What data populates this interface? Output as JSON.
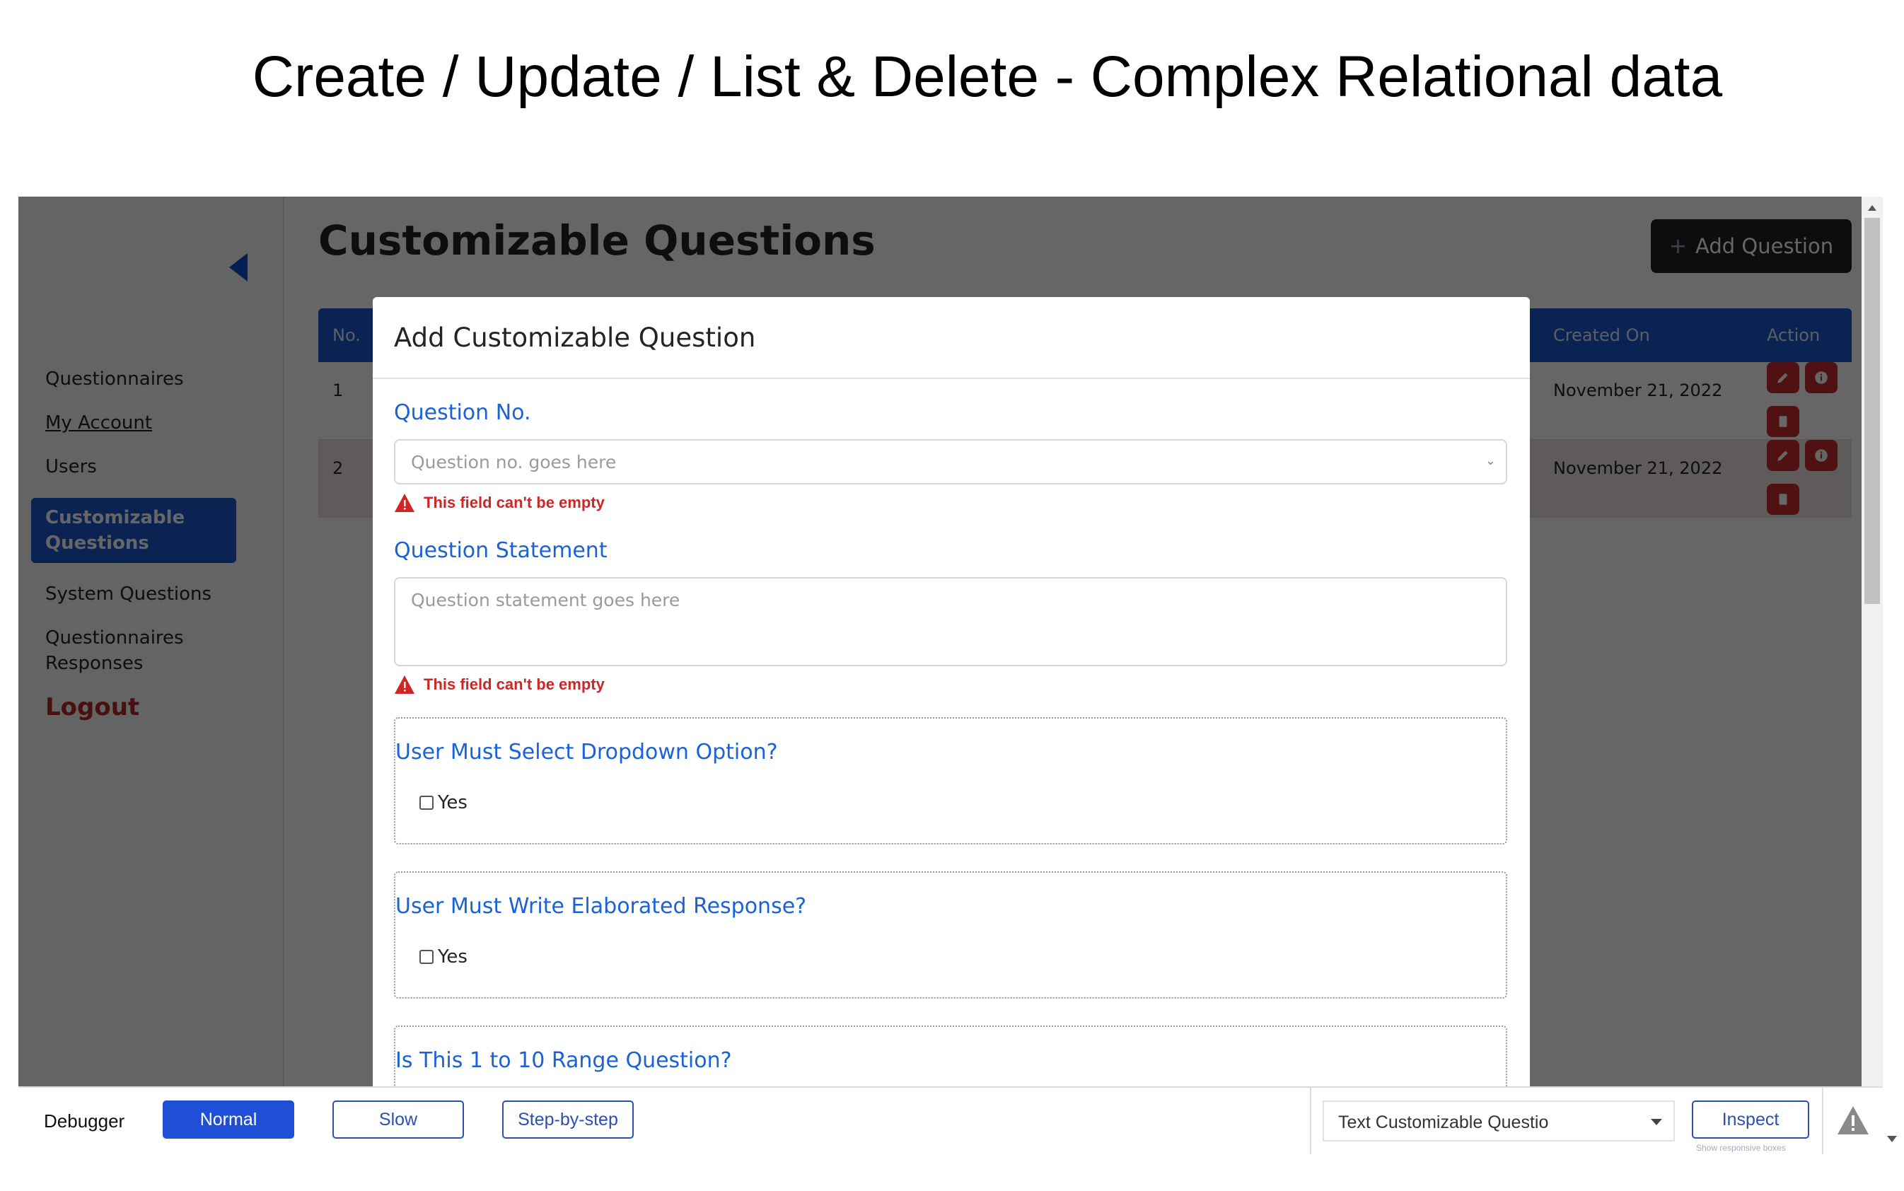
{
  "page_title": "Create / Update / List & Delete - Complex Relational data",
  "sidebar": {
    "items": [
      {
        "label": "Questionnaires"
      },
      {
        "label": "My Account"
      },
      {
        "label": "Users"
      },
      {
        "label": "Customizable Questions",
        "active": true
      },
      {
        "label": "System Questions"
      },
      {
        "label": "Questionnaires Responses"
      }
    ],
    "logout_label": "Logout"
  },
  "main": {
    "title": "Customizable Questions",
    "add_button_label": "Add Question",
    "add_button_icon": "plus-icon",
    "table": {
      "headers": {
        "no": "No.",
        "created_on": "Created On",
        "action": "Action"
      },
      "rows": [
        {
          "no": "1",
          "created_on": "November 21, 2022",
          "actions": [
            "edit-icon",
            "info-icon",
            "delete-icon"
          ]
        },
        {
          "no": "2",
          "created_on": "November 21, 2022",
          "actions": [
            "edit-icon",
            "info-icon",
            "delete-icon"
          ]
        }
      ]
    }
  },
  "modal": {
    "title": "Add Customizable Question",
    "question_no": {
      "label": "Question No.",
      "placeholder": "Question no. goes here",
      "error": "This field can't be empty"
    },
    "question_statement": {
      "label": "Question Statement",
      "placeholder": "Question statement goes here",
      "error": "This field can't be empty"
    },
    "options": [
      {
        "question": "User Must Select Dropdown Option?",
        "checkbox_label": "Yes",
        "checked": false
      },
      {
        "question": "User Must Write Elaborated Response?",
        "checkbox_label": "Yes",
        "checked": false
      },
      {
        "question": "Is This 1 to 10 Range Question?"
      }
    ]
  },
  "debugger": {
    "label": "Debugger",
    "modes": [
      "Normal",
      "Slow",
      "Step-by-step"
    ],
    "active_mode": "Normal",
    "element_select": "Text Customizable Questio",
    "inspect_label": "Inspect",
    "inspect_hint": "Show responsive boxes"
  },
  "colors": {
    "primary": "#1b59cf",
    "danger": "#c62b2b",
    "label_blue": "#1a62d6",
    "error_red": "#d02525"
  }
}
